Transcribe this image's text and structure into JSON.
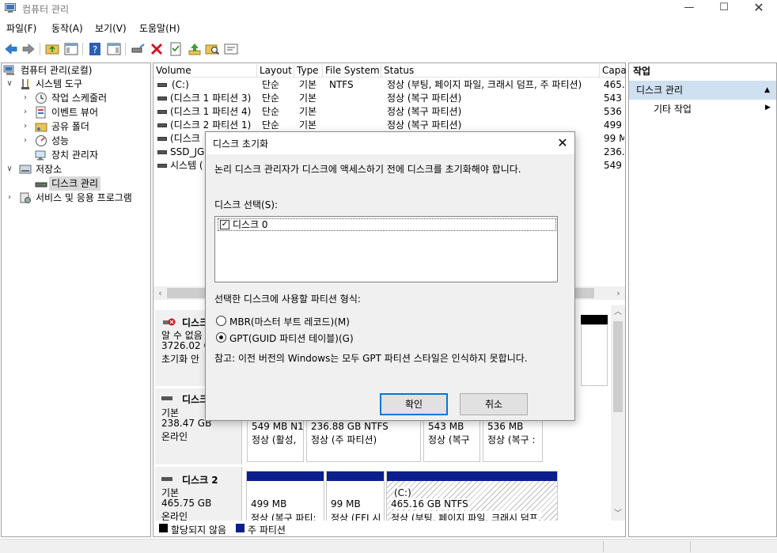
{
  "window": {
    "title": "컴퓨터 관리",
    "min_glyph": "—",
    "max_glyph": "☐",
    "close_glyph": "✕"
  },
  "menu": [
    "파일(F)",
    "동작(A)",
    "보기(V)",
    "도움말(H)"
  ],
  "tree": {
    "root": "컴퓨터 관리(로컬)",
    "system_tools": "시스템 도구",
    "task_scheduler": "작업 스케줄러",
    "event_viewer": "이벤트 뷰어",
    "shared_folders": "공유 폴더",
    "performance": "성능",
    "device_manager": "장치 관리자",
    "storage": "저장소",
    "disk_management": "디스크 관리",
    "services": "서비스 및 응용 프로그램"
  },
  "volumes": {
    "headers": [
      "Volume",
      "Layout",
      "Type",
      "File System",
      "Status",
      "Capa"
    ],
    "rows": [
      {
        "volume": "(C:)",
        "layout": "단순",
        "type": "기본",
        "fs": "NTFS",
        "status": "정상 (부팅, 페이지 파일, 크래시 덤프, 주 파티션)",
        "cap": "465.1"
      },
      {
        "volume": "(디스크 1 파티션 3)",
        "layout": "단순",
        "type": "기본",
        "fs": "",
        "status": "정상 (복구 파티션)",
        "cap": "543 I"
      },
      {
        "volume": "(디스크 1 파티션 4)",
        "layout": "단순",
        "type": "기본",
        "fs": "",
        "status": "정상 (복구 파티션)",
        "cap": "536 I"
      },
      {
        "volume": "(디스크 2 파티션 1)",
        "layout": "단순",
        "type": "기본",
        "fs": "",
        "status": "정상 (복구 파티션)",
        "cap": "499 I"
      },
      {
        "volume": "(디스크",
        "layout": "",
        "type": "",
        "fs": "",
        "status": "",
        "cap": "99 M"
      },
      {
        "volume": "SSD_JG1",
        "layout": "",
        "type": "",
        "fs": "",
        "status": "",
        "cap": "236.8"
      },
      {
        "volume": "시스템 (",
        "layout": "",
        "type": "",
        "fs": "",
        "status": "",
        "cap": "549 I"
      }
    ]
  },
  "disks": {
    "disk0": {
      "name": "디스크",
      "l1": "알 수 없음",
      "l2": "3726.02 G",
      "l3": "초기화 안"
    },
    "disk1": {
      "name": "디스크",
      "l1": "기본",
      "l2": "238.47 GB",
      "l3": "온라인",
      "parts": [
        {
          "size": "549 MB N1",
          "status": "정상 (활성,"
        },
        {
          "size": "236.88 GB NTFS",
          "status": "정상 (주 파티션)"
        },
        {
          "size": "543 MB",
          "status": "정상 (복구"
        },
        {
          "size": "536 MB",
          "status": "정상 (복구 :"
        }
      ]
    },
    "disk2": {
      "name": "디스크 2",
      "l1": "기본",
      "l2": "465.75 GB",
      "l3": "온라인",
      "parts": [
        {
          "name": "",
          "size": "499 MB",
          "status": "정상 (복구 파티:"
        },
        {
          "name": "",
          "size": "99 MB",
          "status": "정상 (EFI 시"
        },
        {
          "name": "(C:)",
          "size": "465.16 GB NTFS",
          "status": "정상 (부팅, 페이지 파일, 크래시 덤프,"
        }
      ]
    }
  },
  "legend": {
    "unallocated": "할당되지 않음",
    "primary": "주 파티션",
    "unallocated_color": "#000000",
    "primary_color": "#0b1e8c"
  },
  "actions": {
    "header": "작업",
    "selected": "디스크 관리",
    "other": "기타 작업"
  },
  "dialog": {
    "title": "디스크 초기화",
    "instruction": "논리 디스크 관리자가 디스크에 액세스하기 전에 디스크를 초기화해야 합니다.",
    "select_label": "디스크 선택(S):",
    "disk_item": "디스크 0",
    "disk_checked": true,
    "partition_style_label": "선택한 디스크에 사용할 파티션 형식:",
    "mbr_label": "MBR(마스터 부트 레코드)(M)",
    "gpt_label": "GPT(GUID 파티션 테이블)(G)",
    "selected_style": "GPT",
    "note": "참고: 이전 버전의 Windows는 모두 GPT 파티션 스타일은 인식하지 못합니다.",
    "ok_label": "확인",
    "cancel_label": "취소",
    "close_glyph": "✕",
    "check_glyph": "✓"
  },
  "colors": {
    "accent": "#0078d7",
    "selection": "#cfe0f1",
    "primary_partition": "#0b1e8c"
  }
}
